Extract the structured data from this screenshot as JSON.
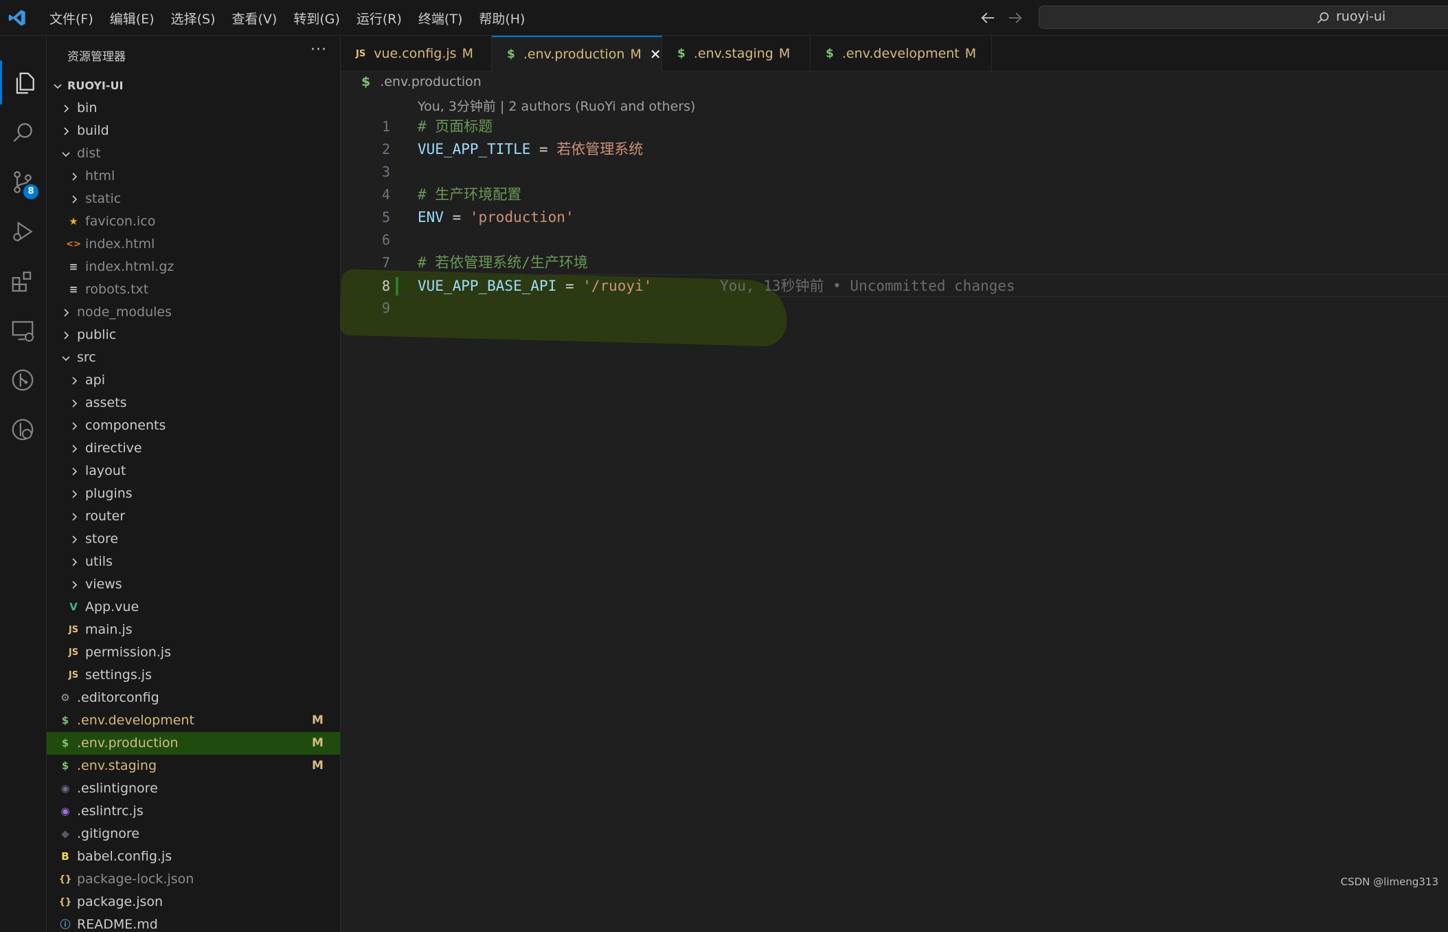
{
  "titlebar": {
    "menu": [
      "文件(F)",
      "编辑(E)",
      "选择(S)",
      "查看(V)",
      "转到(G)",
      "运行(R)",
      "终端(T)",
      "帮助(H)"
    ],
    "search_text": "ruoyi-ui",
    "icons": [
      "vscode-logo",
      "arrow-left-icon",
      "arrow-right-icon",
      "search-icon"
    ]
  },
  "activitybar": {
    "items": [
      "explorer-icon",
      "search-icon",
      "source-control-icon",
      "run-debug-icon",
      "extensions-icon",
      "remote-explorer-icon",
      "git-graph-icon",
      "git-history-icon"
    ],
    "scm_badge": "8",
    "accent": "#0078d4"
  },
  "sidebar": {
    "title": "资源管理器",
    "more": "···",
    "root": "RUOYI-UI",
    "tree": [
      {
        "label": "bin",
        "type": "folder",
        "depth": 1,
        "open": false
      },
      {
        "label": "build",
        "type": "folder",
        "depth": 1,
        "open": false
      },
      {
        "label": "dist",
        "type": "folder",
        "depth": 1,
        "open": true,
        "muted": true
      },
      {
        "label": "html",
        "type": "folder",
        "depth": 2,
        "open": false,
        "muted": true
      },
      {
        "label": "static",
        "type": "folder",
        "depth": 2,
        "open": false,
        "muted": true
      },
      {
        "label": "favicon.ico",
        "type": "file",
        "depth": 2,
        "icon": "star-icon",
        "glyph": "★",
        "color": "#e6b422",
        "muted": true
      },
      {
        "label": "index.html",
        "type": "file",
        "depth": 2,
        "icon": "html-icon",
        "glyph": "<>",
        "color": "#e37933",
        "muted": true
      },
      {
        "label": "index.html.gz",
        "type": "file",
        "depth": 2,
        "icon": "text-file-icon",
        "glyph": "≡",
        "color": "#cccccc",
        "muted": true
      },
      {
        "label": "robots.txt",
        "type": "file",
        "depth": 2,
        "icon": "text-file-icon",
        "glyph": "≡",
        "color": "#cccccc",
        "muted": true
      },
      {
        "label": "node_modules",
        "type": "folder",
        "depth": 1,
        "open": false,
        "muted": true
      },
      {
        "label": "public",
        "type": "folder",
        "depth": 1,
        "open": false
      },
      {
        "label": "src",
        "type": "folder",
        "depth": 1,
        "open": true
      },
      {
        "label": "api",
        "type": "folder",
        "depth": 2,
        "open": false
      },
      {
        "label": "assets",
        "type": "folder",
        "depth": 2,
        "open": false
      },
      {
        "label": "components",
        "type": "folder",
        "depth": 2,
        "open": false
      },
      {
        "label": "directive",
        "type": "folder",
        "depth": 2,
        "open": false
      },
      {
        "label": "layout",
        "type": "folder",
        "depth": 2,
        "open": false
      },
      {
        "label": "plugins",
        "type": "folder",
        "depth": 2,
        "open": false
      },
      {
        "label": "router",
        "type": "folder",
        "depth": 2,
        "open": false
      },
      {
        "label": "store",
        "type": "folder",
        "depth": 2,
        "open": false
      },
      {
        "label": "utils",
        "type": "folder",
        "depth": 2,
        "open": false
      },
      {
        "label": "views",
        "type": "folder",
        "depth": 2,
        "open": false
      },
      {
        "label": "App.vue",
        "type": "file",
        "depth": 2,
        "icon": "vue-icon",
        "glyph": "V",
        "color": "#41b883"
      },
      {
        "label": "main.js",
        "type": "file",
        "depth": 2,
        "icon": "js-icon",
        "glyph": "JS",
        "color": "#e5c07b"
      },
      {
        "label": "permission.js",
        "type": "file",
        "depth": 2,
        "icon": "js-icon",
        "glyph": "JS",
        "color": "#e5c07b"
      },
      {
        "label": "settings.js",
        "type": "file",
        "depth": 2,
        "icon": "js-icon",
        "glyph": "JS",
        "color": "#e5c07b"
      },
      {
        "label": ".editorconfig",
        "type": "file",
        "depth": 1,
        "icon": "gear-icon",
        "glyph": "⚙",
        "color": "#9aa0a6"
      },
      {
        "label": ".env.development",
        "type": "file",
        "depth": 1,
        "icon": "dollar-icon",
        "glyph": "$",
        "color": "#7ec16e",
        "labelColor": "#d7ba7d",
        "badge": "M"
      },
      {
        "label": ".env.production",
        "type": "file",
        "depth": 1,
        "icon": "dollar-icon",
        "glyph": "$",
        "color": "#7ec16e",
        "labelColor": "#d7ba7d",
        "badge": "M",
        "selected": true
      },
      {
        "label": ".env.staging",
        "type": "file",
        "depth": 1,
        "icon": "dollar-icon",
        "glyph": "$",
        "color": "#7ec16e",
        "labelColor": "#d7ba7d",
        "badge": "M"
      },
      {
        "label": ".eslintignore",
        "type": "file",
        "depth": 1,
        "icon": "eslint-icon",
        "glyph": "◉",
        "color": "#6c6c8c"
      },
      {
        "label": ".eslintrc.js",
        "type": "file",
        "depth": 1,
        "icon": "eslint-icon",
        "glyph": "◉",
        "color": "#a070e0"
      },
      {
        "label": ".gitignore",
        "type": "file",
        "depth": 1,
        "icon": "git-icon",
        "glyph": "◆",
        "color": "#555a6b"
      },
      {
        "label": "babel.config.js",
        "type": "file",
        "depth": 1,
        "icon": "babel-icon",
        "glyph": "B",
        "color": "#f5da55"
      },
      {
        "label": "package-lock.json",
        "type": "file",
        "depth": 1,
        "icon": "json-icon",
        "glyph": "{}",
        "color": "#e5c07b",
        "muted": true
      },
      {
        "label": "package.json",
        "type": "file",
        "depth": 1,
        "icon": "json-icon",
        "glyph": "{}",
        "color": "#e5c07b"
      },
      {
        "label": "README.md",
        "type": "file",
        "depth": 1,
        "icon": "info-icon",
        "glyph": "ⓘ",
        "color": "#519aba"
      }
    ]
  },
  "editor": {
    "tabs": [
      {
        "label": "vue.config.js",
        "icon": "js-icon",
        "glyph": "JS",
        "mod": "M",
        "active": false
      },
      {
        "label": ".env.production",
        "icon": "dollar-icon",
        "glyph": "$",
        "mod": "M",
        "active": true,
        "close": "✕"
      },
      {
        "label": ".env.staging",
        "icon": "dollar-icon",
        "glyph": "$",
        "mod": "M",
        "active": false
      },
      {
        "label": ".env.development",
        "icon": "dollar-icon",
        "glyph": "$",
        "mod": "M",
        "active": false
      }
    ],
    "breadcrumb": {
      "icon": "$",
      "text": ".env.production"
    },
    "blame_header": "You, 3分钟前 | 2 authors (RuoYi and others)",
    "current_line": 8,
    "lines": [
      {
        "n": "1",
        "tokens": [
          {
            "t": "# 页面标题",
            "c": "comment"
          }
        ]
      },
      {
        "n": "2",
        "tokens": [
          {
            "t": "VUE_APP_TITLE",
            "c": "key"
          },
          {
            "t": " = ",
            "c": "op"
          },
          {
            "t": "若依管理系统",
            "c": "str"
          }
        ]
      },
      {
        "n": "3",
        "tokens": []
      },
      {
        "n": "4",
        "tokens": [
          {
            "t": "# 生产环境配置",
            "c": "comment"
          }
        ]
      },
      {
        "n": "5",
        "tokens": [
          {
            "t": "ENV",
            "c": "key"
          },
          {
            "t": " = ",
            "c": "op"
          },
          {
            "t": "'production'",
            "c": "str"
          }
        ]
      },
      {
        "n": "6",
        "tokens": []
      },
      {
        "n": "7",
        "tokens": [
          {
            "t": "# 若依管理系统/生产环境",
            "c": "comment"
          }
        ]
      },
      {
        "n": "8",
        "tokens": [
          {
            "t": "VUE_APP_BASE_API",
            "c": "key"
          },
          {
            "t": " = ",
            "c": "op"
          },
          {
            "t": "'/ruoyi'",
            "c": "str"
          }
        ],
        "blame": "You, 13秒钟前 • Uncommitted changes"
      },
      {
        "n": "9",
        "tokens": []
      }
    ]
  },
  "watermark": "CSDN @limeng313"
}
